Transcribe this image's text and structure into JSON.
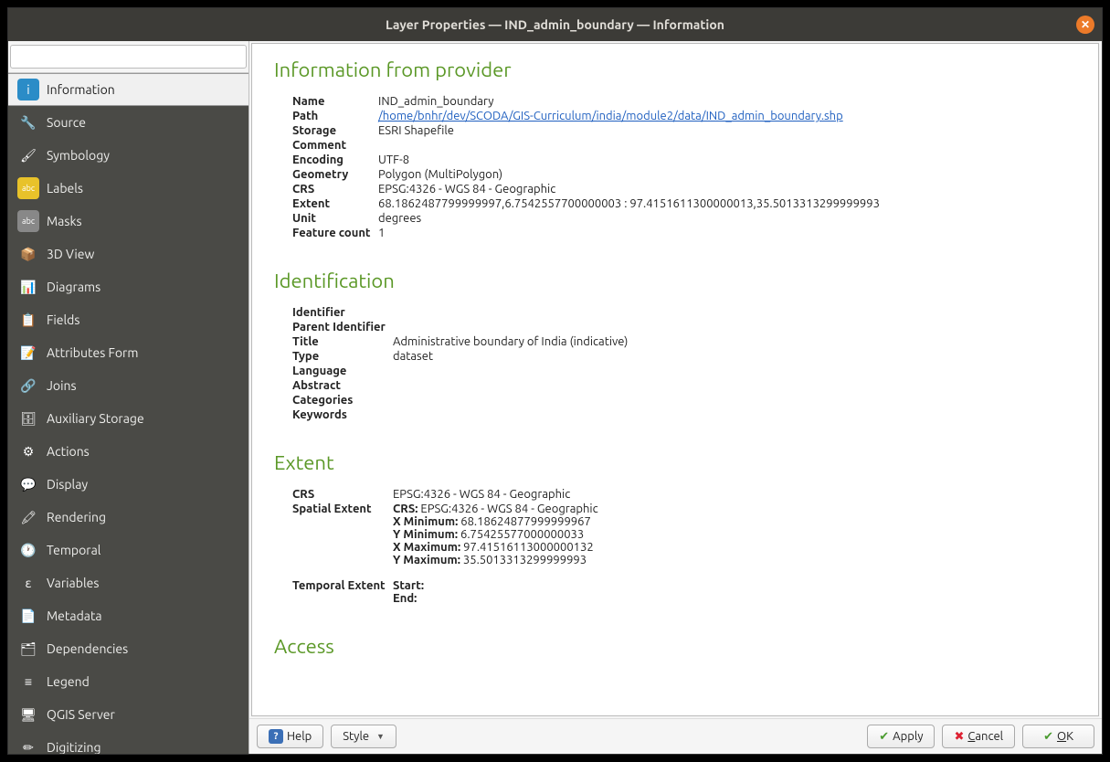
{
  "window": {
    "title": "Layer Properties — IND_admin_boundary — Information"
  },
  "search": {
    "placeholder": ""
  },
  "sidebar": {
    "items": [
      {
        "label": "Information",
        "icon_bg": "#2b8cc7",
        "icon": "i"
      },
      {
        "label": "Source",
        "icon_bg": "#4a4a46",
        "icon": "🔧"
      },
      {
        "label": "Symbology",
        "icon_bg": "#4a4a46",
        "icon": "🖌"
      },
      {
        "label": "Labels",
        "icon_bg": "#e8c22a",
        "icon": "abc"
      },
      {
        "label": "Masks",
        "icon_bg": "#888",
        "icon": "abc"
      },
      {
        "label": "3D View",
        "icon_bg": "#4a4a46",
        "icon": "📦"
      },
      {
        "label": "Diagrams",
        "icon_bg": "#4a4a46",
        "icon": "📊"
      },
      {
        "label": "Fields",
        "icon_bg": "#4a4a46",
        "icon": "📋"
      },
      {
        "label": "Attributes Form",
        "icon_bg": "#4a4a46",
        "icon": "📝"
      },
      {
        "label": "Joins",
        "icon_bg": "#4a4a46",
        "icon": "🔗"
      },
      {
        "label": "Auxiliary Storage",
        "icon_bg": "#4a4a46",
        "icon": "🗄"
      },
      {
        "label": "Actions",
        "icon_bg": "#4a4a46",
        "icon": "⚙"
      },
      {
        "label": "Display",
        "icon_bg": "#4a4a46",
        "icon": "💬"
      },
      {
        "label": "Rendering",
        "icon_bg": "#4a4a46",
        "icon": "🖍"
      },
      {
        "label": "Temporal",
        "icon_bg": "#4a4a46",
        "icon": "🕐"
      },
      {
        "label": "Variables",
        "icon_bg": "#4a4a46",
        "icon": "ε"
      },
      {
        "label": "Metadata",
        "icon_bg": "#4a4a46",
        "icon": "📄"
      },
      {
        "label": "Dependencies",
        "icon_bg": "#4a4a46",
        "icon": "🗂"
      },
      {
        "label": "Legend",
        "icon_bg": "#4a4a46",
        "icon": "≡"
      },
      {
        "label": "QGIS Server",
        "icon_bg": "#4a4a46",
        "icon": "🖥"
      },
      {
        "label": "Digitizing",
        "icon_bg": "#4a4a46",
        "icon": "✏"
      }
    ],
    "active_index": 0
  },
  "sections": {
    "provider": {
      "heading": "Information from provider",
      "rows": [
        {
          "k": "Name",
          "v": "IND_admin_boundary"
        },
        {
          "k": "Path",
          "v": "/home/bnhr/dev/SCODA/GIS-Curriculum/india/module2/data/IND_admin_boundary.shp",
          "link": true
        },
        {
          "k": "Storage",
          "v": "ESRI Shapefile"
        },
        {
          "k": "Comment",
          "v": ""
        },
        {
          "k": "Encoding",
          "v": "UTF-8"
        },
        {
          "k": "Geometry",
          "v": "Polygon (MultiPolygon)"
        },
        {
          "k": "CRS",
          "v": "EPSG:4326 - WGS 84 - Geographic"
        },
        {
          "k": "Extent",
          "v": "68.1862487799999997,6.7542557700000003 : 97.4151611300000013,35.5013313299999993"
        },
        {
          "k": "Unit",
          "v": "degrees"
        },
        {
          "k": "Feature count",
          "v": "1"
        }
      ]
    },
    "identification": {
      "heading": "Identification",
      "rows": [
        {
          "k": "Identifier",
          "v": ""
        },
        {
          "k": "Parent Identifier",
          "v": ""
        },
        {
          "k": "Title",
          "v": "Administrative boundary of India (indicative)"
        },
        {
          "k": "Type",
          "v": "dataset"
        },
        {
          "k": "Language",
          "v": ""
        },
        {
          "k": "Abstract",
          "v": ""
        },
        {
          "k": "Categories",
          "v": ""
        },
        {
          "k": "Keywords",
          "v": ""
        }
      ]
    },
    "extent": {
      "heading": "Extent",
      "crs_label": "CRS",
      "crs_value": "EPSG:4326 - WGS 84 - Geographic",
      "spatial_label": "Spatial Extent",
      "spatial": {
        "crs_k": "CRS:",
        "crs_v": "EPSG:4326 - WGS 84 - Geographic",
        "xmin_k": "X Minimum:",
        "xmin_v": "68.18624877999999967",
        "ymin_k": "Y Minimum:",
        "ymin_v": "6.75425577000000033",
        "xmax_k": "X Maximum:",
        "xmax_v": "97.41516113000000132",
        "ymax_k": "Y Maximum:",
        "ymax_v": "35.5013313299999993"
      },
      "temporal_label": "Temporal Extent",
      "temporal": {
        "start_k": "Start:",
        "start_v": "",
        "end_k": "End:",
        "end_v": ""
      }
    },
    "access": {
      "heading": "Access"
    }
  },
  "buttons": {
    "help": "Help",
    "style": "Style",
    "apply": "Apply",
    "cancel": "Cancel",
    "ok": "OK"
  }
}
